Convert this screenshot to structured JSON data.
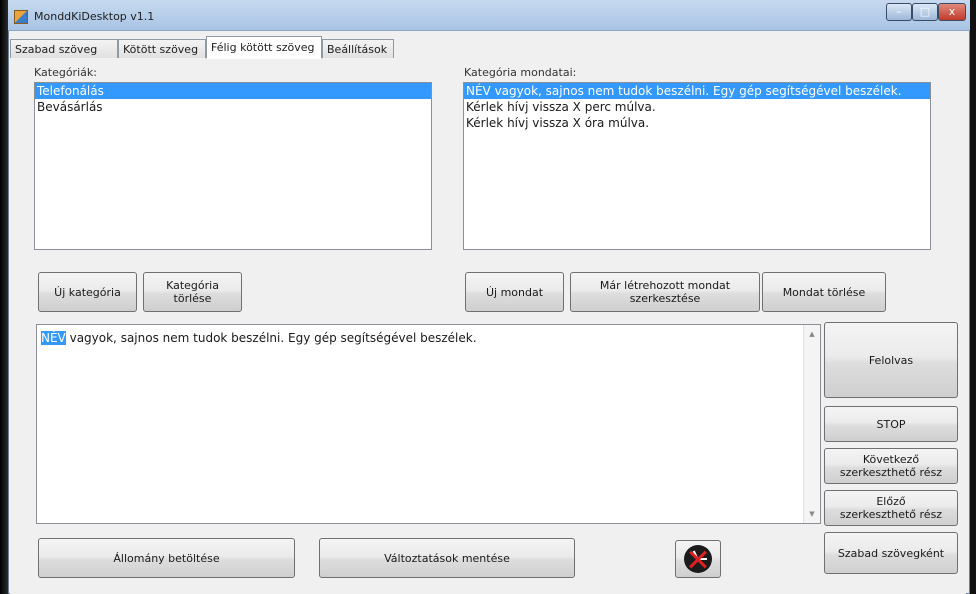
{
  "window": {
    "title": "MonddKiDesktop v1.1",
    "controls": {
      "minimize": "–",
      "maximize": "□",
      "close": "x"
    }
  },
  "tabs": [
    {
      "label": "Szabad szöveg"
    },
    {
      "label": "Kötött szöveg"
    },
    {
      "label": "Félig kötött szöveg"
    },
    {
      "label": "Beállítások"
    }
  ],
  "categories": {
    "label": "Kategóriák:",
    "items": [
      "Telefonálás",
      "Bevásárlás"
    ],
    "selected_index": 0
  },
  "sentences": {
    "label": "Kategória mondatai:",
    "items": [
      "NÉV vagyok, sajnos nem tudok beszélni. Egy gép segítségével beszélek.",
      "Kérlek hívj vissza X perc múlva.",
      "Kérlek hívj vissza X óra múlva."
    ],
    "selected_index": 0
  },
  "buttons": {
    "new_category": "Új kategória",
    "delete_category": "Kategória\ntörlése",
    "new_sentence": "Új mondat",
    "edit_sentence": "Már létrehozott mondat\nszerkesztése",
    "delete_sentence": "Mondat törlése",
    "read_aloud": "Felolvas",
    "stop": "STOP",
    "next_part": "Következő\nszerkeszthető rész",
    "prev_part": "Előző\nszerkeszthető rész",
    "as_free_text": "Szabad szövegként",
    "load_file": "Állomány betöltése",
    "save_changes": "Változtatások mentése"
  },
  "editor": {
    "highlighted": "NÉV",
    "rest": " vagyok, sajnos nem tudok beszélni. Egy gép segítségével beszélek."
  },
  "icons": {
    "clock_button": "clock-off-icon"
  },
  "colors": {
    "selection": "#3399ff",
    "window_bg": "#f0f0f0"
  }
}
